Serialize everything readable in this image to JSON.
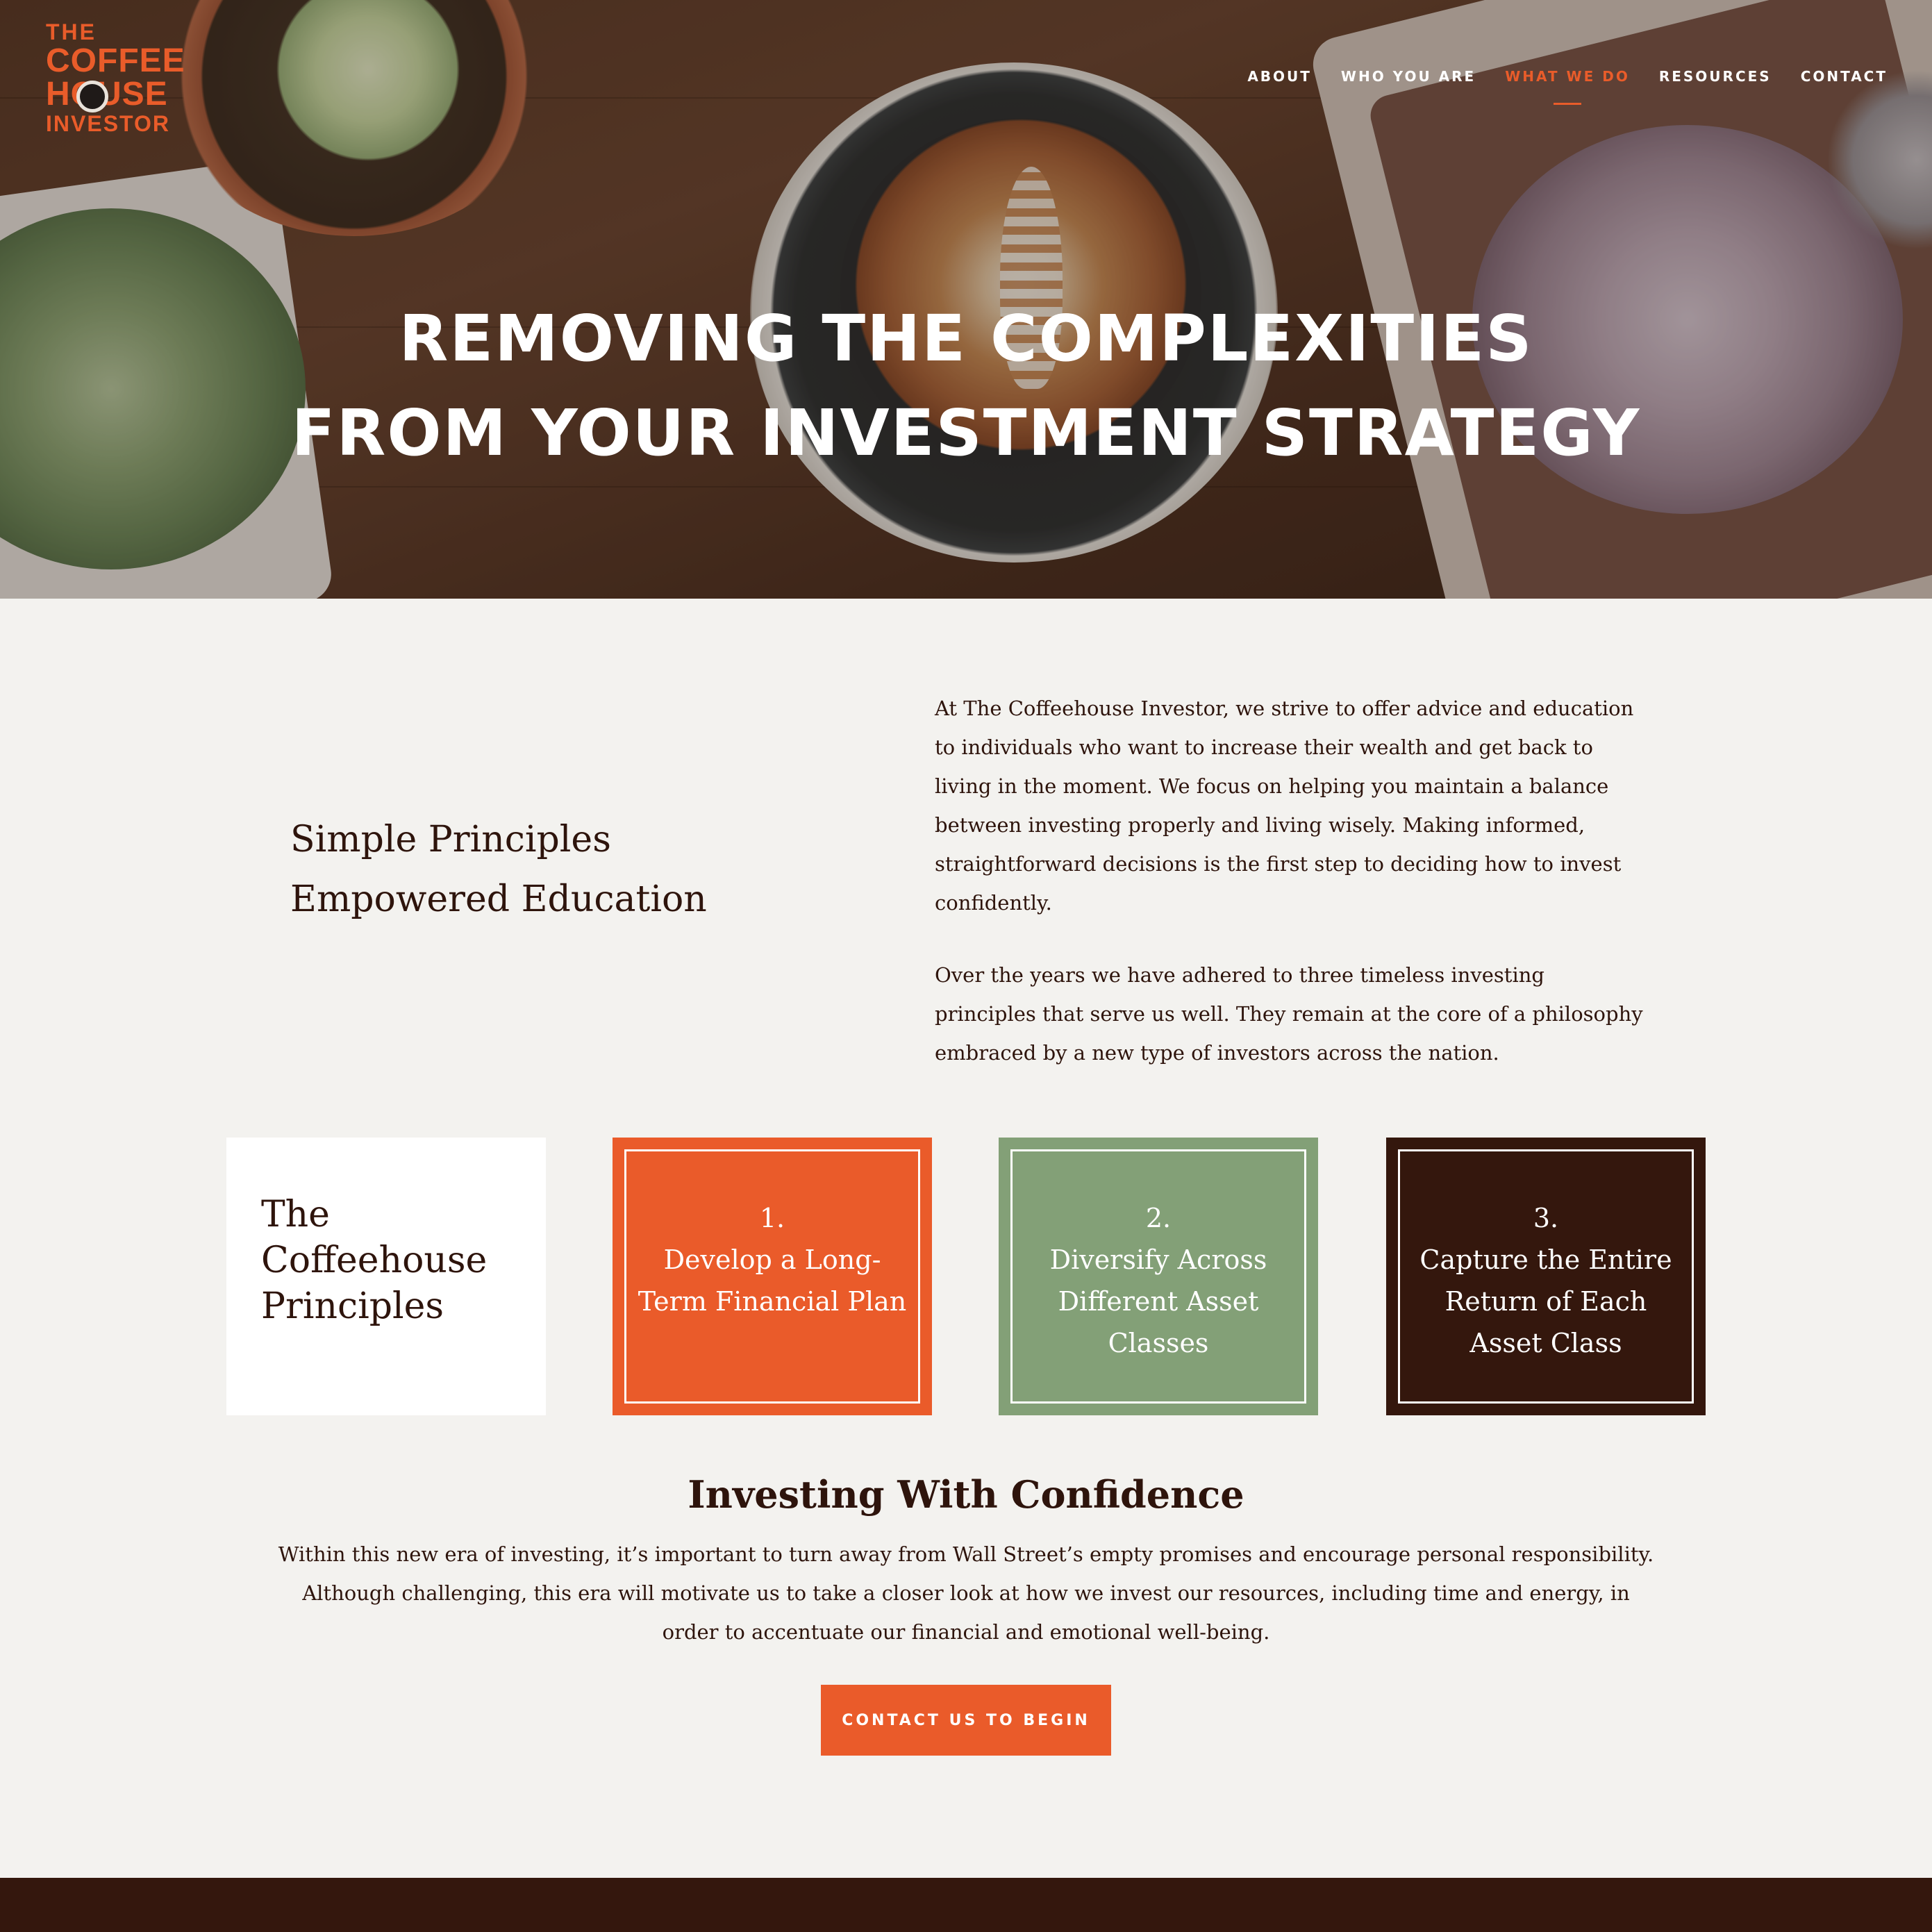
{
  "brand": {
    "logo_line1": "THE",
    "logo_line2": "COFFEE",
    "logo_line3": "HOUSE",
    "logo_line4": "INVESTOR",
    "accent_color": "#e95c2a",
    "dark_color": "#34170d",
    "green_color": "#83a077"
  },
  "nav": {
    "items": [
      {
        "label": "ABOUT",
        "active": false
      },
      {
        "label": "WHO YOU ARE",
        "active": false
      },
      {
        "label": "WHAT WE DO",
        "active": true
      },
      {
        "label": "RESOURCES",
        "active": false
      },
      {
        "label": "CONTACT",
        "active": false
      }
    ]
  },
  "hero": {
    "title_line1": "REMOVING THE COMPLEXITIES",
    "title_line2": "FROM YOUR INVESTMENT STRATEGY"
  },
  "intro": {
    "tagline_line1": "Simple Principles",
    "tagline_line2": "Empowered Education",
    "paragraph1": "At The Coffeehouse Investor, we strive to offer advice and education to individuals who want to increase their wealth and get back to living in the moment. We focus on helping you maintain a balance between investing properly and living wisely. Making informed, straightforward decisions is the first step to deciding how to invest confidently.",
    "paragraph2": "Over the years we have adhered to three timeless investing principles that serve us well. They remain at the core of a philosophy embraced by a new type of investors across the nation."
  },
  "principles": {
    "heading": "The Coffeehouse Principles",
    "items": [
      {
        "number": "1.",
        "text": "Develop a Long-Term Financial Plan"
      },
      {
        "number": "2.",
        "text": "Diversify Across Different Asset Classes"
      },
      {
        "number": "3.",
        "text": "Capture the Entire Return of Each Asset Class"
      }
    ]
  },
  "confidence": {
    "title": "Investing With Confidence",
    "body": "Within this new era of investing, it’s important to turn away from Wall Street’s empty promises and encourage personal responsibility. Although challenging, this era will motivate us to take a closer look at how we invest our resources, including time and energy, in order to accentuate our financial and emotional well-being.",
    "cta_label": "CONTACT US TO BEGIN"
  }
}
